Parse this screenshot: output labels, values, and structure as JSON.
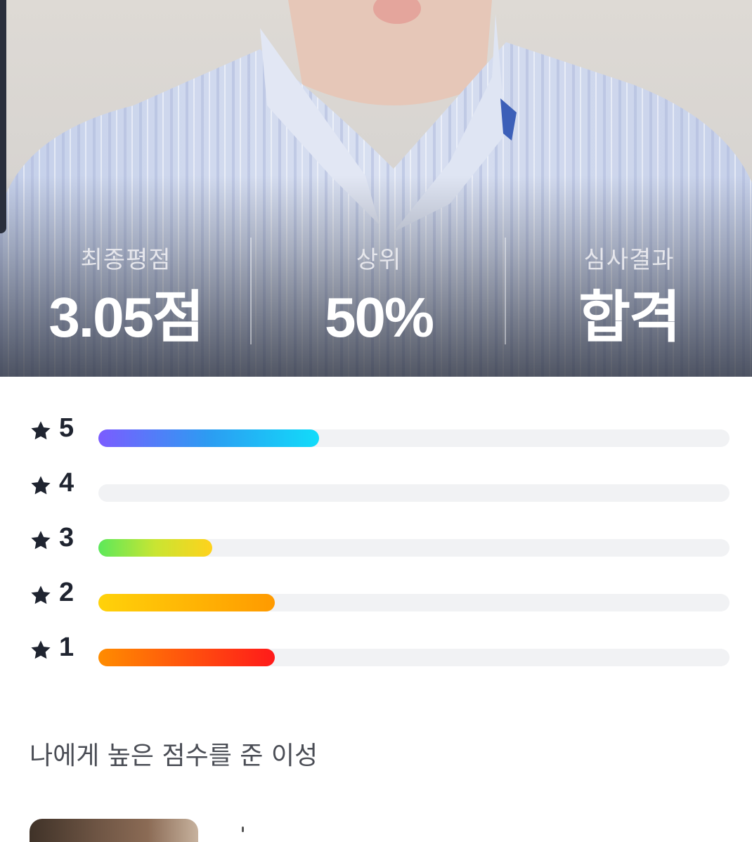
{
  "stats": [
    {
      "label": "최종평점",
      "value": "3.05점"
    },
    {
      "label": "상위",
      "value": "50%"
    },
    {
      "label": "심사결과",
      "value": "합격"
    }
  ],
  "ratings": [
    {
      "stars": "5",
      "fraction": 0.35,
      "gradient": [
        "#7b5cff",
        "#2c9cf2",
        "#11dcfa"
      ]
    },
    {
      "stars": "4",
      "fraction": 0.0,
      "gradient": [
        "#f1f2f4",
        "#f1f2f4"
      ]
    },
    {
      "stars": "3",
      "fraction": 0.18,
      "gradient": [
        "#5ce85a",
        "#c9e532",
        "#ffd21c"
      ]
    },
    {
      "stars": "2",
      "fraction": 0.28,
      "gradient": [
        "#ffd20a",
        "#ff9a00"
      ]
    },
    {
      "stars": "1",
      "fraction": 0.28,
      "gradient": [
        "#ff8c00",
        "#ff1a1a"
      ]
    }
  ],
  "section": {
    "title": "나에게 높은 점수를 준 이성"
  },
  "icons": {
    "rating": "star-icon"
  },
  "colors": {
    "text_dark": "#1f2430",
    "track": "#f1f2f4"
  }
}
